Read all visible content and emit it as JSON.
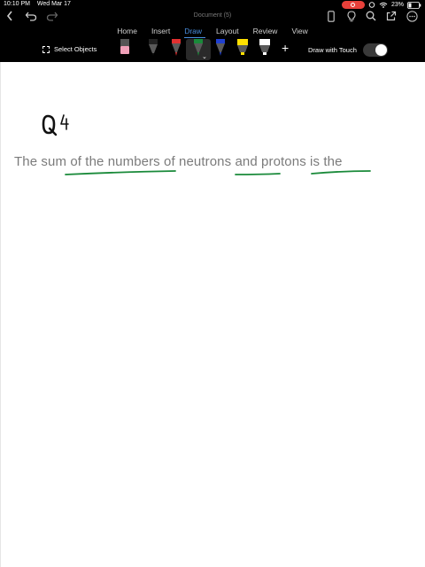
{
  "status_bar": {
    "time": "10:10 PM",
    "date": "Wed Mar 17",
    "battery": "23%"
  },
  "document": {
    "title": "Document (5)"
  },
  "ribbon": {
    "tabs": [
      {
        "label": "Home"
      },
      {
        "label": "Insert"
      },
      {
        "label": "Draw",
        "active": true
      },
      {
        "label": "Layout"
      },
      {
        "label": "Review"
      },
      {
        "label": "View"
      }
    ],
    "select_objects_label": "Select Objects",
    "draw_with_touch_label": "Draw with Touch",
    "draw_with_touch_on": true,
    "pens": [
      {
        "name": "eraser",
        "color": "#f0a0b8"
      },
      {
        "name": "pen-black",
        "color": "#111111"
      },
      {
        "name": "pen-red",
        "color": "#e03030"
      },
      {
        "name": "pen-green",
        "color": "#1a8a3a",
        "selected": true
      },
      {
        "name": "pen-blue",
        "color": "#2040d0"
      },
      {
        "name": "highlighter-yellow",
        "color": "#ffe000"
      },
      {
        "name": "highlighter-white",
        "color": "#ffffff"
      }
    ]
  },
  "page": {
    "handwriting": "Q4",
    "text": "The sum of the numbers of neutrons and protons is the",
    "annotation_color": "#1a8a3a"
  }
}
